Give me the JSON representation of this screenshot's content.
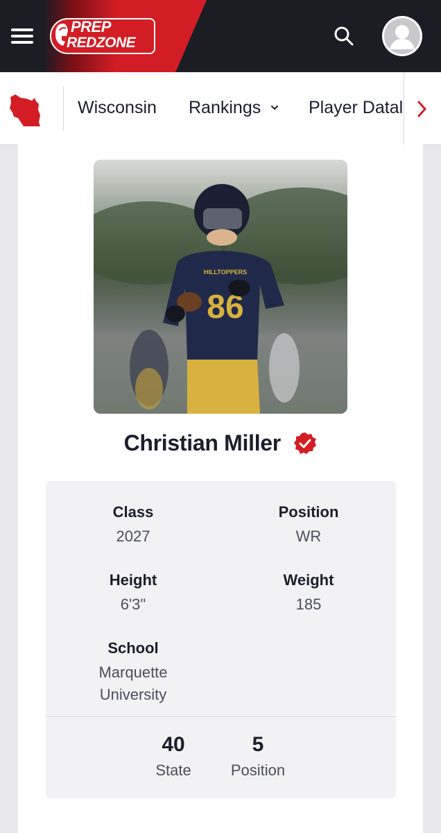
{
  "header": {
    "logo_line1": "PREP",
    "logo_line2": "REDZONE",
    "menu_icon": "hamburger-menu-icon",
    "search_icon": "search-icon",
    "avatar_icon": "user-avatar-icon"
  },
  "nav": {
    "state_icon": "wisconsin-state-icon",
    "items": [
      {
        "label": "Wisconsin"
      },
      {
        "label": "Rankings"
      },
      {
        "label": "Player Datal"
      }
    ],
    "more_icon": "chevron-right-icon"
  },
  "player": {
    "name": "Christian Miller",
    "verified_icon": "verified-badge-icon",
    "photo_jersey_text": "HILLTOPPERS",
    "photo_jersey_number": "86",
    "details": {
      "class_label": "Class",
      "class_value": "2027",
      "position_label": "Position",
      "position_value": "WR",
      "height_label": "Height",
      "height_value": "6'3\"",
      "weight_label": "Weight",
      "weight_value": "185",
      "school_label": "School",
      "school_value_line1": "Marquette",
      "school_value_line2": "University"
    },
    "rankings": [
      {
        "value": "40",
        "label": "State"
      },
      {
        "value": "5",
        "label": "Position"
      }
    ]
  },
  "colors": {
    "brand_red": "#d31d25",
    "header_dark": "#1b1c24",
    "text_dark": "#1c1e2b"
  }
}
